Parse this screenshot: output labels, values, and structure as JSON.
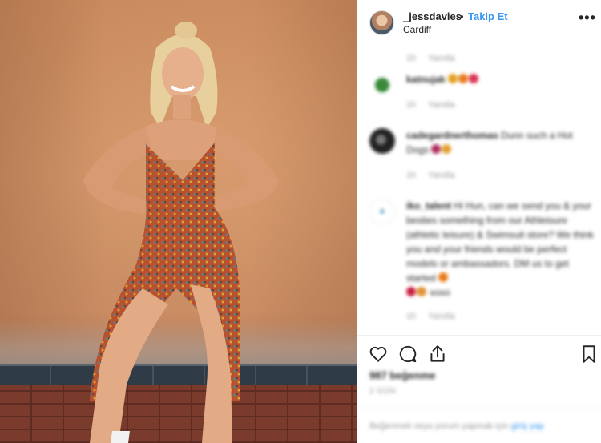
{
  "post": {
    "username": "_jessdavies",
    "separator": "•",
    "follow_label": "Takip Et",
    "location": "Cardiff",
    "more_label": "•••"
  },
  "comments": [
    {
      "meta_time": "1h",
      "meta_reply": "Yanıtla"
    },
    {
      "username": "katnujak",
      "text": "",
      "meta_time": "1h",
      "meta_reply": "Yanıtla"
    },
    {
      "username": "cadegardnerthomas",
      "text": "Dunn such a Hot Dogs",
      "meta_time": "1h",
      "meta_reply": "Yanıtla"
    },
    {
      "username": "iko_talent",
      "text": "Hi Hun, can we send you & your besties something from our Athleisure (athletic leisure) & Swimsuit store? We think you and your friends would be perfect models or ambassadors. DM us to get started",
      "text_tail": "xoxo",
      "meta_time": "1h",
      "meta_reply": "Yanıtla"
    }
  ],
  "actions": {
    "likes": "987 beğenme",
    "time_ago": "2 GÜN"
  },
  "add_comment": {
    "hint": "Beğenmek veya yorum yapmak için",
    "login": "giriş yap"
  },
  "colors": {
    "link": "#3897f0",
    "text": "#262626",
    "muted": "#999999",
    "border": "#efefef"
  },
  "icons": [
    "heart-icon",
    "comment-icon",
    "share-icon",
    "bookmark-icon",
    "more-options-icon"
  ]
}
